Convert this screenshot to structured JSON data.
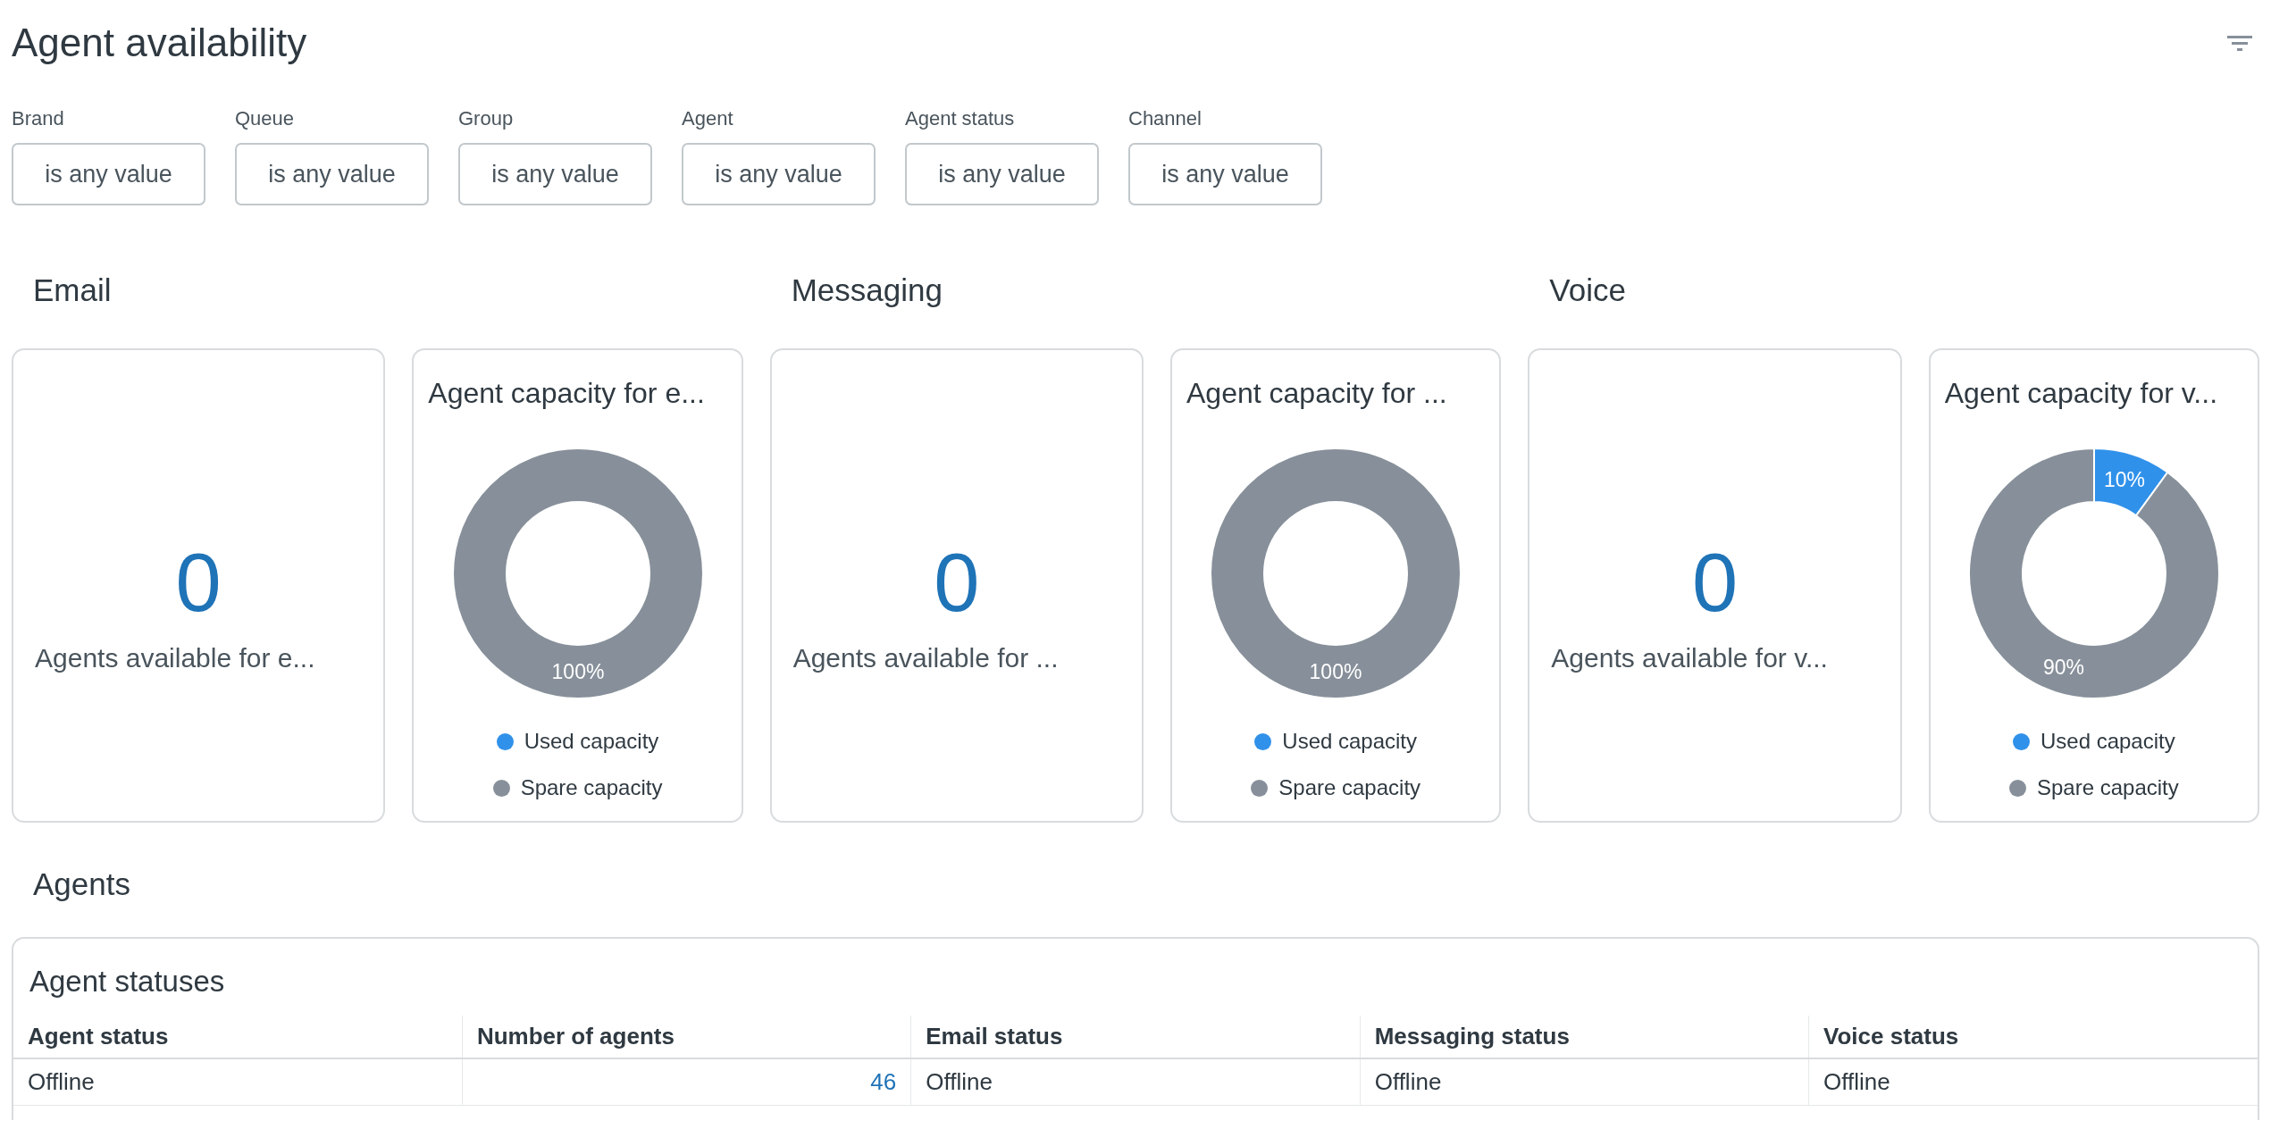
{
  "page": {
    "title": "Agent availability"
  },
  "filters": [
    {
      "label": "Brand",
      "value": "is any value"
    },
    {
      "label": "Queue",
      "value": "is any value"
    },
    {
      "label": "Group",
      "value": "is any value"
    },
    {
      "label": "Agent",
      "value": "is any value"
    },
    {
      "label": "Agent status",
      "value": "is any value"
    },
    {
      "label": "Channel",
      "value": "is any value"
    }
  ],
  "sections": [
    {
      "title": "Email",
      "availability": {
        "value": "0",
        "label": "Agents available for e..."
      },
      "capacity": {
        "title": "Agent capacity for e...",
        "legend": [
          {
            "color": "#3091ea"
          },
          {
            "color": "#87909a"
          }
        ],
        "chart_data": {
          "type": "donut",
          "categories": [
            "Used capacity",
            "Spare capacity"
          ],
          "values": [
            0,
            100
          ],
          "value_labels": [
            null,
            "100%"
          ]
        }
      }
    },
    {
      "title": "Messaging",
      "availability": {
        "value": "0",
        "label": "Agents available for ..."
      },
      "capacity": {
        "title": "Agent capacity for ...",
        "legend": [
          {
            "color": "#3091ea"
          },
          {
            "color": "#87909a"
          }
        ],
        "chart_data": {
          "type": "donut",
          "categories": [
            "Used capacity",
            "Spare capacity"
          ],
          "values": [
            0,
            100
          ],
          "value_labels": [
            null,
            "100%"
          ]
        }
      }
    },
    {
      "title": "Voice",
      "availability": {
        "value": "0",
        "label": "Agents available for v..."
      },
      "capacity": {
        "title": "Agent capacity for v...",
        "legend": [
          {
            "color": "#3091ea"
          },
          {
            "color": "#87909a"
          }
        ],
        "chart_data": {
          "type": "donut",
          "categories": [
            "Used capacity",
            "Spare capacity"
          ],
          "values": [
            10,
            90
          ],
          "value_labels": [
            "10%",
            "90%"
          ]
        }
      }
    }
  ],
  "agents": {
    "title": "Agents",
    "table": {
      "title": "Agent statuses",
      "columns": [
        {
          "label": "Agent status",
          "kind": "text"
        },
        {
          "label": "Number of agents",
          "kind": "number"
        },
        {
          "label": "Email status",
          "kind": "text"
        },
        {
          "label": "Messaging status",
          "kind": "text"
        },
        {
          "label": "Voice status",
          "kind": "text"
        }
      ],
      "rows": [
        [
          "Offline",
          "46",
          "Offline",
          "Offline",
          "Offline"
        ]
      ]
    }
  }
}
